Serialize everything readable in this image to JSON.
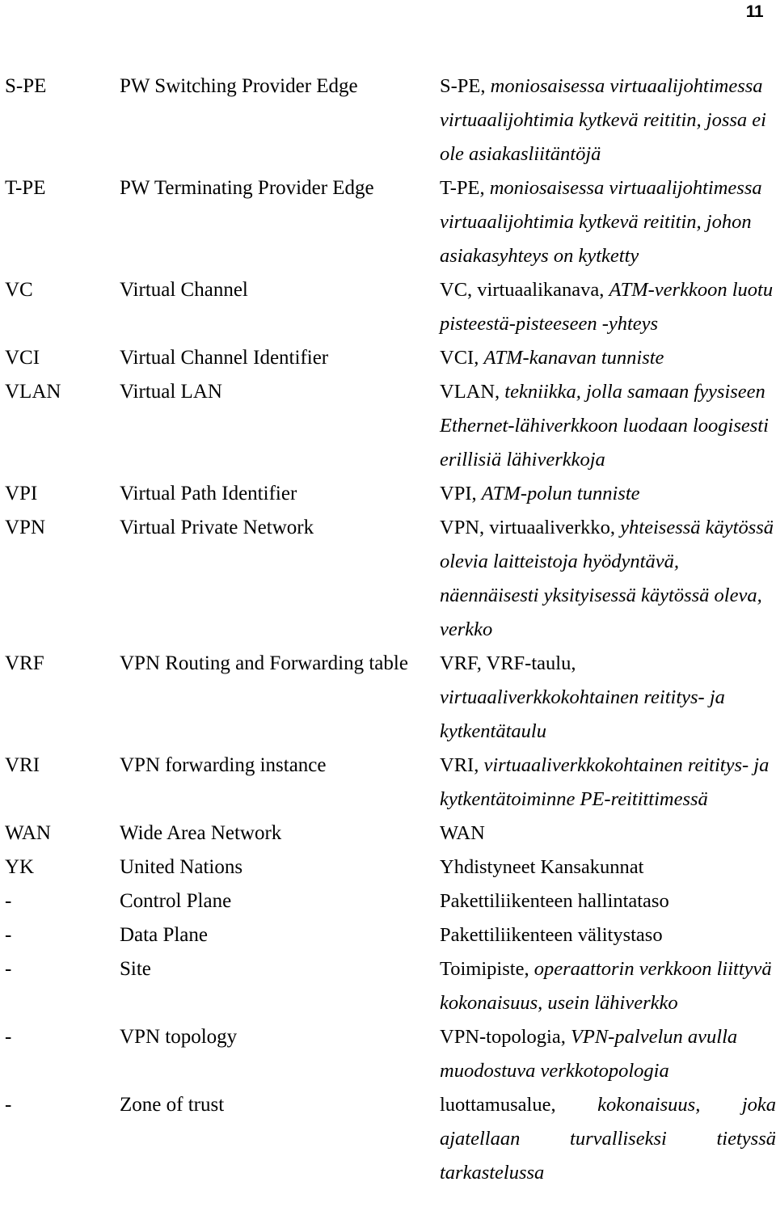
{
  "document": {
    "page_number": "11",
    "type": "glossary-abbreviations-table",
    "language_left": "English",
    "language_right": "Finnish"
  },
  "rows": [
    {
      "abbr": "S-PE",
      "english": "PW Switching Provider Edge",
      "fi_lead": "S-PE,",
      "fi_def": "moniosaisessa virtuaalijohtimessa virtuaalijohtimia kytkevä reititin, jossa ei ole asiakasliitäntöjä",
      "justify": false
    },
    {
      "abbr": "T-PE",
      "english": "PW Terminating Provider Edge",
      "fi_lead": "T-PE,",
      "fi_def": "moniosaisessa virtuaalijohtimessa virtuaalijohtimia kytkevä reititin, johon asiakasyhteys on kytketty",
      "justify": false
    },
    {
      "abbr": "VC",
      "english": "Virtual Channel",
      "fi_lead": "VC, virtuaalikanava,",
      "fi_def": "ATM-verkkoon luotu pisteestä-pisteeseen -yhteys",
      "justify": false
    },
    {
      "abbr": "VCI",
      "english": "Virtual Channel Identifier",
      "fi_lead": "VCI,",
      "fi_def": "ATM-kanavan tunniste",
      "justify": false
    },
    {
      "abbr": "VLAN",
      "english": "Virtual LAN",
      "fi_lead": "VLAN,",
      "fi_def": "tekniikka, jolla samaan fyysiseen Ethernet-lähiverkkoon luodaan loogisesti erillisiä lähiverkkoja",
      "justify": false
    },
    {
      "abbr": "VPI",
      "english": "Virtual Path Identifier",
      "fi_lead": "VPI,",
      "fi_def": "ATM-polun tunniste",
      "justify": false
    },
    {
      "abbr": "VPN",
      "english": "Virtual Private Network",
      "fi_lead": "VPN, virtuaaliverkko,",
      "fi_def": "yhteisessä käytössä olevia laitteistoja hyödyntävä, näennäisesti yksityisessä käytössä oleva, verkko",
      "justify": false
    },
    {
      "abbr": "VRF",
      "english": "VPN Routing and Forwarding table",
      "fi_lead": "VRF, VRF-taulu,",
      "fi_def": "virtuaaliverkkokohtainen reititys- ja kytkentätaulu",
      "justify": false
    },
    {
      "abbr": "VRI",
      "english": "VPN forwarding instance",
      "fi_lead": "VRI,",
      "fi_def": "virtuaaliverkkokohtainen reititys- ja kytkentätoiminne PE-reitittimessä",
      "justify": false
    },
    {
      "abbr": "WAN",
      "english": "Wide Area Network",
      "fi_lead": "WAN",
      "fi_def": "",
      "justify": false
    },
    {
      "abbr": "YK",
      "english": "United Nations",
      "fi_lead": "Yhdistyneet Kansakunnat",
      "fi_def": "",
      "justify": false
    },
    {
      "abbr": "-",
      "english": "Control Plane",
      "fi_lead": "Pakettiliikenteen hallintataso",
      "fi_def": "",
      "justify": false
    },
    {
      "abbr": "-",
      "english": "Data Plane",
      "fi_lead": "Pakettiliikenteen välitystaso",
      "fi_def": "",
      "justify": false
    },
    {
      "abbr": "-",
      "english": "Site",
      "fi_lead": "Toimipiste,",
      "fi_def": "operaattorin verkkoon liittyvä kokonaisuus, usein lähiverkko",
      "justify": false
    },
    {
      "abbr": "-",
      "english": "VPN topology",
      "fi_lead": "VPN-topologia,",
      "fi_def": "VPN-palvelun avulla muodostuva verkkotopologia",
      "justify": false
    },
    {
      "abbr": "-",
      "english": "Zone of trust",
      "fi_lead": "luottamusalue,",
      "fi_def": "kokonaisuus, joka ajatellaan turvalliseksi tietyssä tarkastelussa",
      "justify": true
    }
  ]
}
